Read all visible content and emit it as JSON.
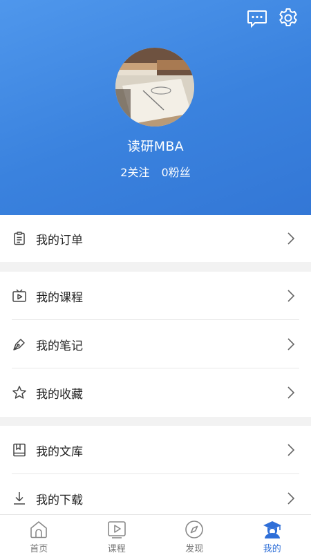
{
  "header": {
    "username": "读研MBA",
    "following": "2关注",
    "followers": "0粉丝",
    "message_icon": "message-icon",
    "settings_icon": "gear-icon",
    "gradient_start": "#4f97ec",
    "gradient_end": "#3377d6"
  },
  "menu": {
    "orders": "我的订单",
    "courses": "我的课程",
    "notes": "我的笔记",
    "favorites": "我的收藏",
    "library": "我的文库",
    "downloads": "我的下载"
  },
  "tabs": {
    "home": "首页",
    "courses": "课程",
    "discover": "发现",
    "mine": "我的",
    "active": "mine",
    "active_color": "#2f6fd8"
  }
}
